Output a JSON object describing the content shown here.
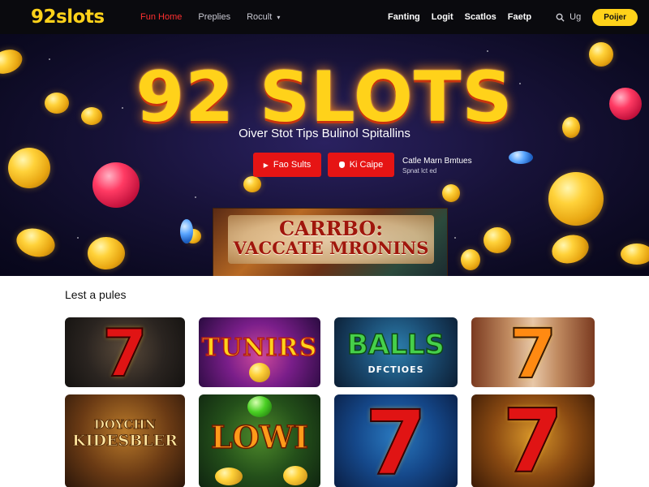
{
  "nav": {
    "logo": "92slots",
    "links": [
      "Fun Home",
      "Preplies",
      "Rocult"
    ],
    "right_links": [
      "Fanting",
      "Logit",
      "Scatlos",
      "Faetp"
    ],
    "search_label": "Ug",
    "cta": "Poijer",
    "icons": {
      "dropdown": "chevron-down-icon",
      "search": "search-icon"
    }
  },
  "hero": {
    "title": "92 SLOTS",
    "subtitle": "Oiver Stot Tips Bulinol Spitallins",
    "buttons": [
      "Fao Sults",
      "Ki Caipe"
    ],
    "note_line1": "Catle Marn Bmtues",
    "note_line2": "Spnat lct ed",
    "banner_line1": "CARRBO:",
    "banner_line2": "VACCATE MRONINS",
    "colors": {
      "accent": "#ffd21a",
      "button": "#e61414",
      "background": "#171238"
    }
  },
  "section": {
    "title": "Lest a pules"
  },
  "games": [
    {
      "label": "7"
    },
    {
      "label": "TUNIRS"
    },
    {
      "label": "BALLS",
      "sub": "DFCTIOES"
    },
    {
      "label": "7"
    },
    {
      "label": "KIDESBLER",
      "sub": "DOYCHN"
    },
    {
      "label": "LOWI"
    },
    {
      "label": "7"
    },
    {
      "label": "7"
    }
  ]
}
